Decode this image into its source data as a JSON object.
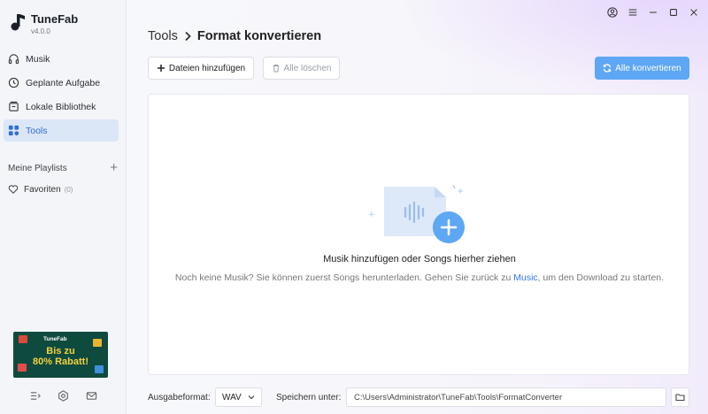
{
  "app": {
    "name": "TuneFab",
    "version": "v4.0.0"
  },
  "sidebar": {
    "items": [
      {
        "label": "Musik",
        "icon": "headphones-icon"
      },
      {
        "label": "Geplante Aufgabe",
        "icon": "clock-icon"
      },
      {
        "label": "Lokale Bibliothek",
        "icon": "library-icon"
      },
      {
        "label": "Tools",
        "icon": "tools-icon",
        "active": true
      }
    ],
    "playlists_label": "Meine Playlists",
    "favorites_label": "Favoriten",
    "favorites_count": "(0)",
    "promo": {
      "brand": "TuneFab",
      "line1": "Bis zu",
      "line2": "80% Rabatt!"
    }
  },
  "header": {
    "crumb_root": "Tools",
    "crumb_page": "Format konvertieren"
  },
  "toolbar": {
    "add_label": "Dateien hinzufügen",
    "clear_label": "Alle löschen",
    "convert_label": "Alle konvertieren"
  },
  "dropzone": {
    "title": "Musik hinzufügen oder Songs hierher ziehen",
    "sub_before": "Noch keine Musik? Sie können zuerst Songs herunterladen. Gehen Sie zurück zu ",
    "sub_link": "Music",
    "sub_after": ", um den Download zu starten."
  },
  "footer": {
    "format_label": "Ausgabeformat:",
    "format_value": "WAV",
    "save_label": "Speichern unter:",
    "save_path": "C:\\Users\\Administrator\\TuneFab\\Tools\\FormatConverter"
  },
  "colors": {
    "accent": "#5ea7f4",
    "active_nav_bg": "#dbe6f7",
    "link": "#3478e5"
  }
}
